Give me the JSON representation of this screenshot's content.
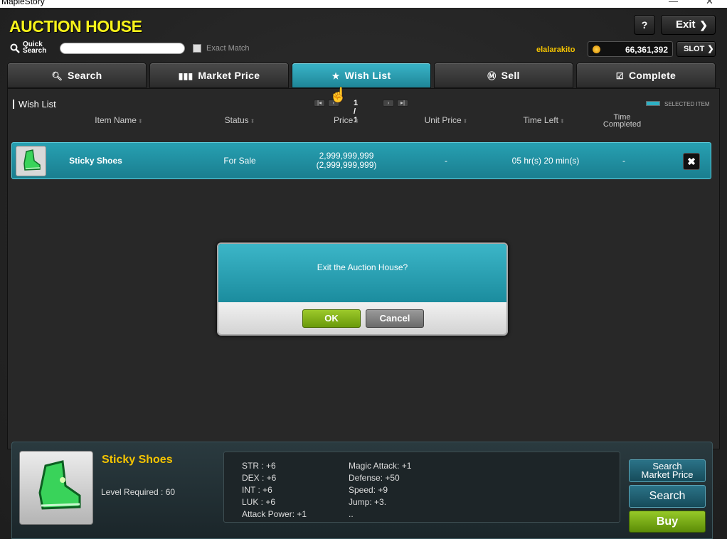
{
  "window": {
    "title": "MapleStory",
    "close": "✕",
    "minimize": "—"
  },
  "header": {
    "title": "AUCTION HOUSE",
    "help_label": "?",
    "exit_label": "Exit",
    "quick_search_label_line1": "Quick",
    "quick_search_label_line2": "Search",
    "quick_search_value": "",
    "exact_match_label": "Exact Match",
    "username": "elalarakito",
    "mesos": "66,361,392",
    "slot_label": "SLOT"
  },
  "tabs": [
    {
      "label": "Search",
      "icon": "search-icon",
      "active": false
    },
    {
      "label": "Market Price",
      "icon": "chart-icon",
      "active": false
    },
    {
      "label": "Wish List",
      "icon": "star-icon",
      "active": true
    },
    {
      "label": "Sell",
      "icon": "mesos-icon",
      "active": false
    },
    {
      "label": "Complete",
      "icon": "checkbox-icon",
      "active": false
    }
  ],
  "wishlist": {
    "title": "Wish List",
    "page": "1 / 1",
    "legend_label": "SELECTED ITEM",
    "headers": {
      "item_name": "Item Name",
      "status": "Status",
      "price": "Price",
      "unit_price": "Unit Price",
      "time_left": "Time Left",
      "time_completed_line1": "Time",
      "time_completed_line2": "Completed"
    },
    "rows": [
      {
        "item_name": "Sticky Shoes",
        "status": "For Sale",
        "price_line1": "2,999,999,999",
        "price_line2": "(2,999,999,999)",
        "unit_price": "-",
        "time_left": "05 hr(s) 20 min(s)",
        "time_completed": "-",
        "delete_label": "✖"
      }
    ]
  },
  "dialog": {
    "message": "Exit the Auction House?",
    "ok_label": "OK",
    "cancel_label": "Cancel"
  },
  "detail": {
    "item_name": "Sticky Shoes",
    "level_required": "Level Required : 60",
    "stats_left": [
      "STR : +6",
      "DEX : +6",
      "INT : +6",
      "LUK : +6",
      "Attack Power: +1"
    ],
    "stats_right": [
      "Magic Attack: +1",
      "Defense: +50",
      "Speed: +9",
      "Jump: +3.",
      ".."
    ],
    "search_market_line1": "Search",
    "search_market_line2": "Market Price",
    "search_label": "Search",
    "buy_label": "Buy"
  },
  "colors": {
    "title_yellow": "#f7f21a",
    "accent_teal": "#2db0c4",
    "gold": "#f5c400",
    "buy_green": "#7fb318"
  }
}
